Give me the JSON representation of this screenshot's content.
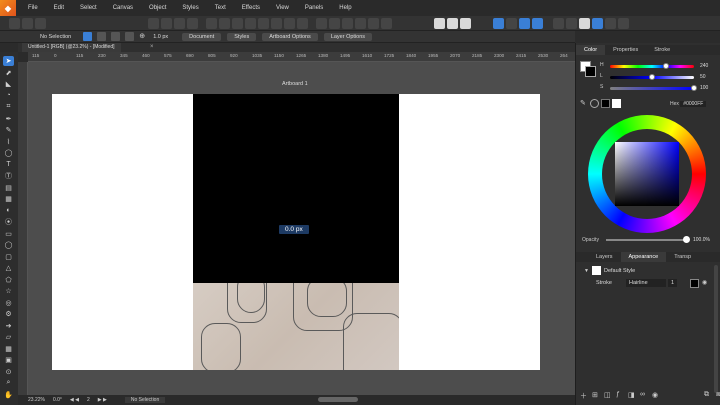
{
  "menu": [
    "File",
    "Edit",
    "Select",
    "Canvas",
    "Object",
    "Styles",
    "Text",
    "Effects",
    "View",
    "Panels",
    "Help"
  ],
  "app_logo_glyph": "◆",
  "context": {
    "selection": "No Selection",
    "stroke_width": "1.0 px",
    "buttons": [
      "Document",
      "Styles",
      "Artboard Options",
      "Layer Options"
    ]
  },
  "document_tab": {
    "title": "Untitled-1 [RGB] (@23.2%) - [Modified]",
    "close": "×"
  },
  "ruler_ticks": [
    "115",
    "0",
    "115",
    "230",
    "345",
    "460",
    "575",
    "690",
    "805",
    "920",
    "1035",
    "1150",
    "1265",
    "1380",
    "1495",
    "1610",
    "1725",
    "1840",
    "1955",
    "2070",
    "2185",
    "2300",
    "2415",
    "2530",
    "264"
  ],
  "artboard": {
    "label": "Artboard 1"
  },
  "measure_tip": "0.0 px",
  "status": {
    "zoom": "23.22%",
    "angle": "0.0°",
    "page": "2",
    "selection": "No Selection"
  },
  "panel": {
    "color_tabs": [
      "Color",
      "Properties",
      "Stroke"
    ],
    "sliders": [
      {
        "label": "H",
        "value": "240",
        "fraction": 0.667
      },
      {
        "label": "L",
        "value": "50",
        "fraction": 0.5
      },
      {
        "label": "S",
        "value": "100",
        "fraction": 1.0
      }
    ],
    "hex_label": "Hex",
    "hex_value": "#0000FF",
    "opacity_label": "Opacity",
    "opacity_value": "100.0%",
    "layer_tabs": [
      "Layers",
      "Appearance",
      "Transp"
    ],
    "appearance": {
      "style_name": "Default Style",
      "stroke_label": "Stroke",
      "stroke_value": "Hairline",
      "stroke_count": "1"
    }
  },
  "colors": {
    "accent": "#3a7fd6",
    "fill": "#0000ff"
  }
}
